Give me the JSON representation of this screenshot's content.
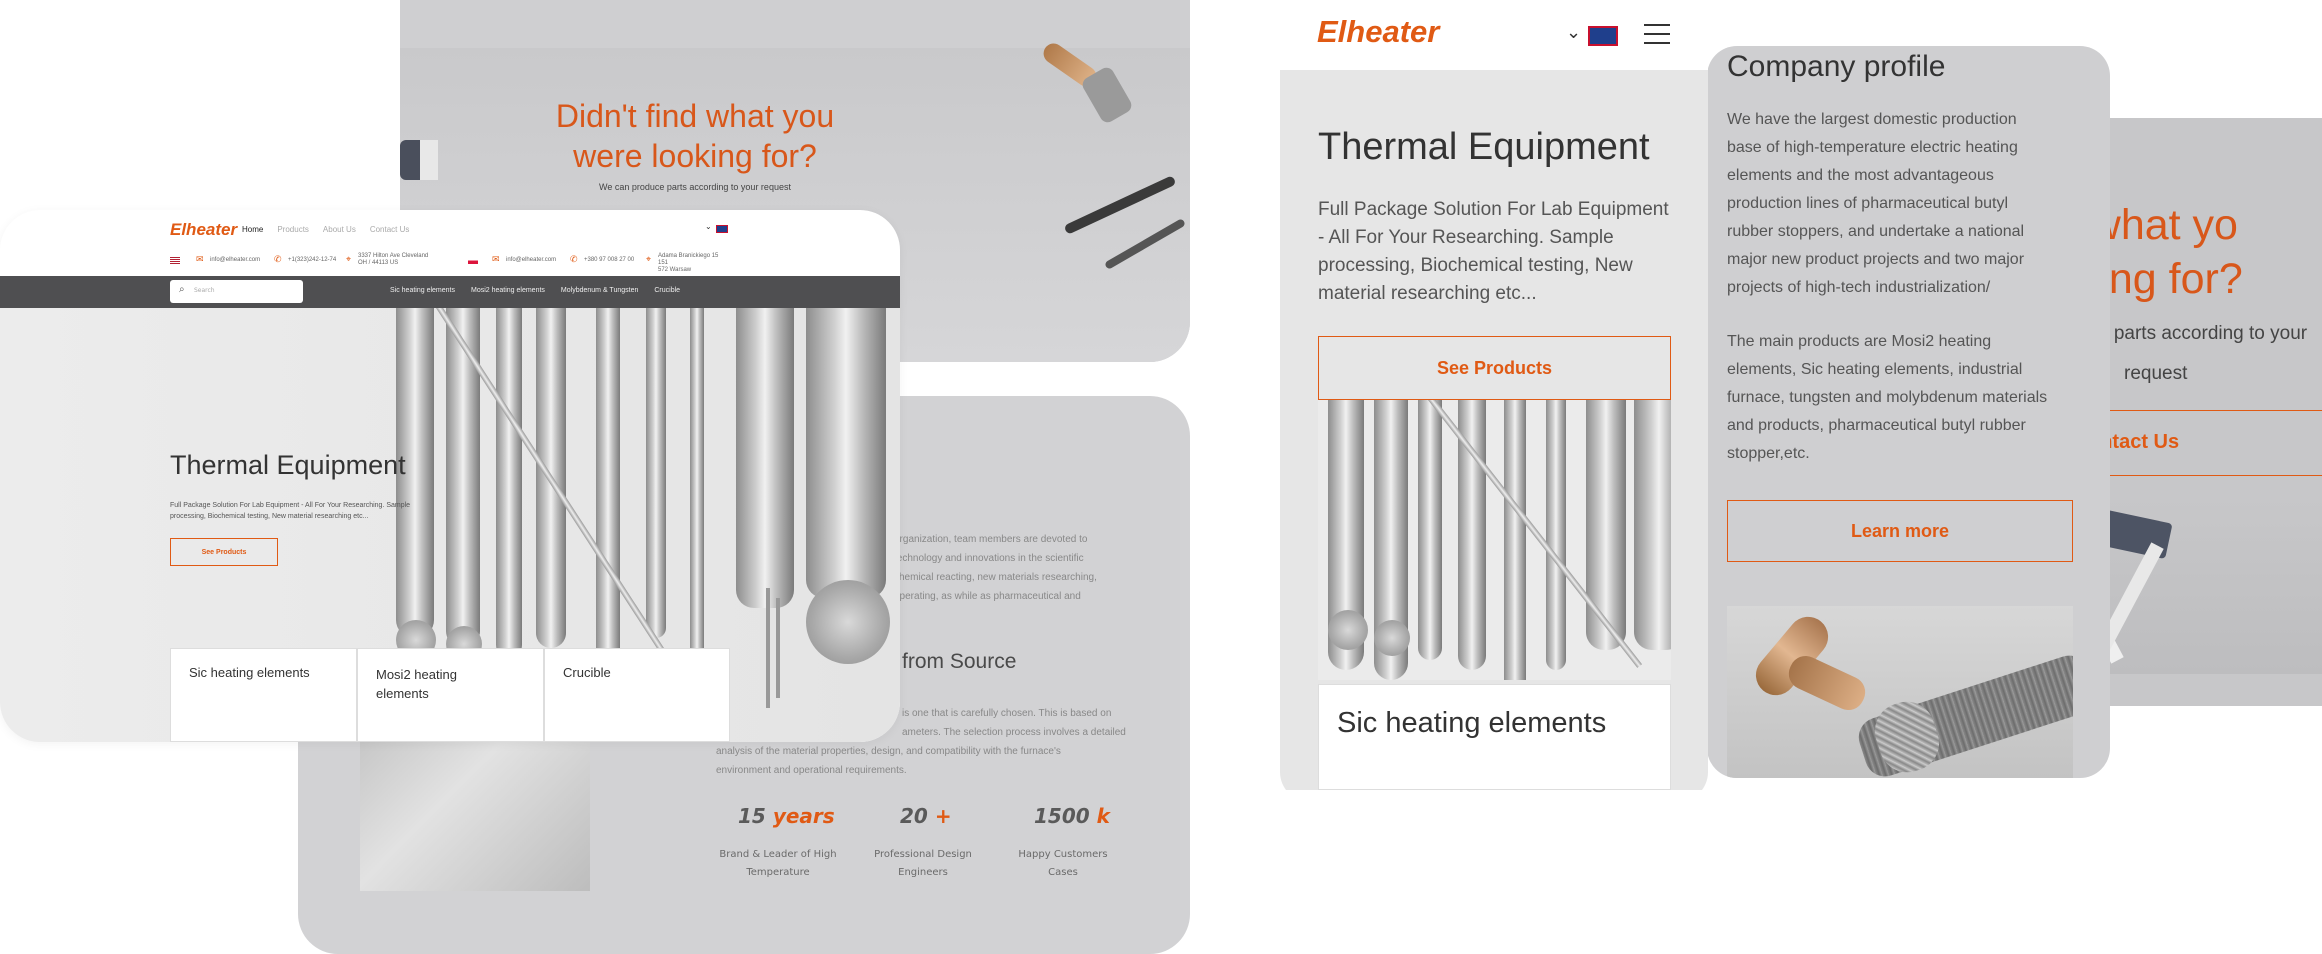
{
  "brand": {
    "logo": "Elheater",
    "accent": "#e05a14"
  },
  "card_top": {
    "heading_line1": "Didn't find what you",
    "heading_line2": "were looking for?",
    "subtext": "We can produce parts according to your request"
  },
  "card_bottom": {
    "para_lines": [
      "organization, team members are devoted to",
      "technology and innovations in the scientific",
      "chemical reacting, new materials researching,",
      "operating, as while as pharmaceutical and"
    ],
    "section_title": "from Source",
    "body_lines": [
      "is one that is carefully chosen. This is based on",
      "ameters. The selection process involves a detailed",
      "analysis of the material properties, design, and compatibility with the furnace's",
      "environment and operational requirements."
    ],
    "stats": [
      {
        "number": "15",
        "suffix": "years",
        "label_l1": "Brand & Leader of High",
        "label_l2": "Temperature"
      },
      {
        "number": "20",
        "suffix": "+",
        "label_l1": "Professional Design",
        "label_l2": "Engineers"
      },
      {
        "number": "1500",
        "suffix": "k",
        "label_l1": "Happy Customers",
        "label_l2": "Cases"
      }
    ]
  },
  "desktop": {
    "nav": [
      "Home",
      "Products",
      "About Us",
      "Contact Us"
    ],
    "contacts": {
      "email1": "info@elheater.com",
      "phone1": "+1(323)242-12-74",
      "address1_l1": "3337 Hilton Ave Cleveland",
      "address1_l2": "OH / 44113 US",
      "email2": "info@elheater.com",
      "phone2": "+380 97 008 27 00",
      "address2_l1": "Adama Branickiego 15 151",
      "address2_l2": "572 Warsaw"
    },
    "search_placeholder": "Search",
    "categories": [
      "Sic heating elements",
      "Mosi2 heating elements",
      "Molybdenum & Tungsten",
      "Crucible"
    ],
    "hero_title": "Thermal Equipment",
    "hero_line1": "Full Package Solution For Lab Equipment - All For Your Researching. Sample",
    "hero_line2": "processing, Biochemical testing, New material researching etc...",
    "hero_button": "See Products",
    "tiles": [
      "Sic heating elements",
      "Mosi2 heating elements",
      "Crucible"
    ],
    "tile2_l1": "Mosi2 heating",
    "tile2_l2": "elements"
  },
  "mobile": {
    "logo": "Elheater",
    "hero_title": "Thermal Equipment",
    "hero_lines": [
      "Full Package Solution For Lab Equipment",
      "- All For Your Researching. Sample",
      "processing, Biochemical testing, New",
      "material researching etc..."
    ],
    "hero_button": "See Products",
    "tile": "Sic heating elements"
  },
  "profile": {
    "title": "Company profile",
    "para1": [
      "We have the largest domestic production",
      "base of high-temperature electric heating",
      "elements and the most advantageous",
      "production lines of pharmaceutical butyl",
      "rubber stoppers, and undertake a national",
      "major new product projects and two major",
      "projects of high-tech industrialization/"
    ],
    "para2": [
      "The main products are Mosi2 heating",
      "elements, Sic heating elements, industrial",
      "furnace, tungsten and molybdenum materials",
      "and products, pharmaceutical butyl rubber",
      "stopper,etc."
    ],
    "button": "Learn more"
  },
  "right_card": {
    "line1": "nd what yo",
    "line2": "ooking for?",
    "line3": "e parts according to your",
    "line4": "request",
    "button": "ontact Us"
  }
}
